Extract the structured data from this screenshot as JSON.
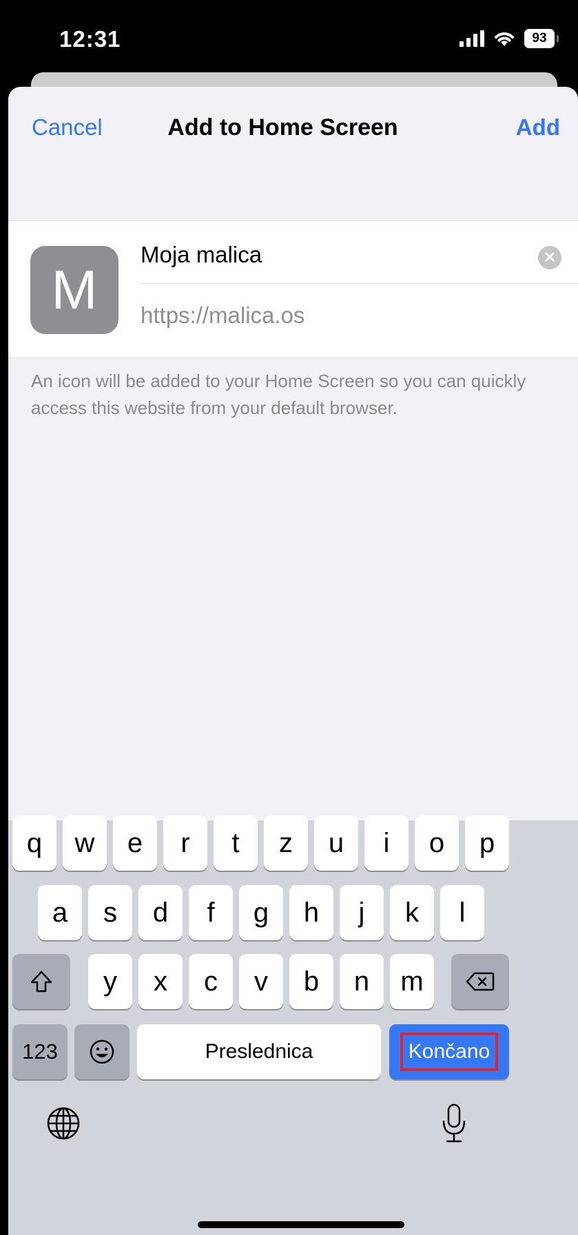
{
  "status_bar": {
    "time": "12:31",
    "battery": "93"
  },
  "nav": {
    "cancel": "Cancel",
    "title": "Add to Home Screen",
    "add": "Add"
  },
  "card": {
    "icon_letter": "M",
    "name_value": "Moja malica",
    "url": "https://malica.os"
  },
  "info_text": "An icon will be added to your Home Screen so you can quickly access this website from your default browser.",
  "keyboard": {
    "row1": [
      "q",
      "w",
      "e",
      "r",
      "t",
      "z",
      "u",
      "i",
      "o",
      "p"
    ],
    "row2": [
      "a",
      "s",
      "d",
      "f",
      "g",
      "h",
      "j",
      "k",
      "l"
    ],
    "row3": [
      "y",
      "x",
      "c",
      "v",
      "b",
      "n",
      "m"
    ],
    "numbers_key": "123",
    "space_label": "Preslednica",
    "done_label": "Končano"
  },
  "colors": {
    "accent": "#3478f6",
    "highlight_border": "#e0262b"
  },
  "icons": [
    "signal-icon",
    "wifi-icon",
    "battery-icon",
    "clear-icon",
    "shift-icon",
    "backspace-icon",
    "emoji-icon",
    "globe-icon",
    "microphone-icon"
  ]
}
